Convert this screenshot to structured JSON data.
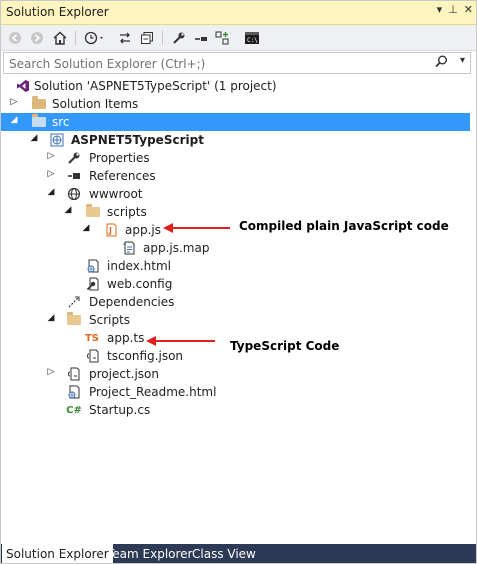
{
  "window": {
    "title": "Solution Explorer",
    "title_icons": [
      "▾",
      "⊥",
      "✕"
    ]
  },
  "toolbar": {
    "buttons": [
      "back-icon",
      "forward-icon",
      "home-icon",
      "history-icon",
      "sync-icon",
      "collapse-icon",
      "properties-icon",
      "pending-changes-icon",
      "preview-icon",
      "terminal-icon"
    ]
  },
  "search": {
    "placeholder": "Search Solution Explorer (Ctrl+;)"
  },
  "tree": {
    "solution": "Solution 'ASPNET5TypeScript' (1 project)",
    "solution_items": "Solution Items",
    "src": "src",
    "project": "ASPNET5TypeScript",
    "properties": "Properties",
    "references": "References",
    "wwwroot": "wwwroot",
    "scripts_lower": "scripts",
    "app_js": "app.js",
    "app_js_map": "app.js.map",
    "index_html": "index.html",
    "web_config": "web.config",
    "dependencies": "Dependencies",
    "scripts_upper": "Scripts",
    "app_ts": "app.ts",
    "tsconfig": "tsconfig.json",
    "project_json": "project.json",
    "readme": "Project_Readme.html",
    "startup": "Startup.cs",
    "ts_badge": "TS",
    "cs_badge": "C#"
  },
  "annotations": {
    "compiled": "Compiled plain JavaScript code",
    "typescript": "TypeScript Code"
  },
  "tabs": [
    "Solution Explorer",
    "Team Explorer",
    "Class View"
  ],
  "colors": {
    "selection": "#3399ff",
    "annotation_arrow": "#e01f1f",
    "title_bar": "#fdf4bf",
    "tab_bar": "#2d3a55"
  }
}
